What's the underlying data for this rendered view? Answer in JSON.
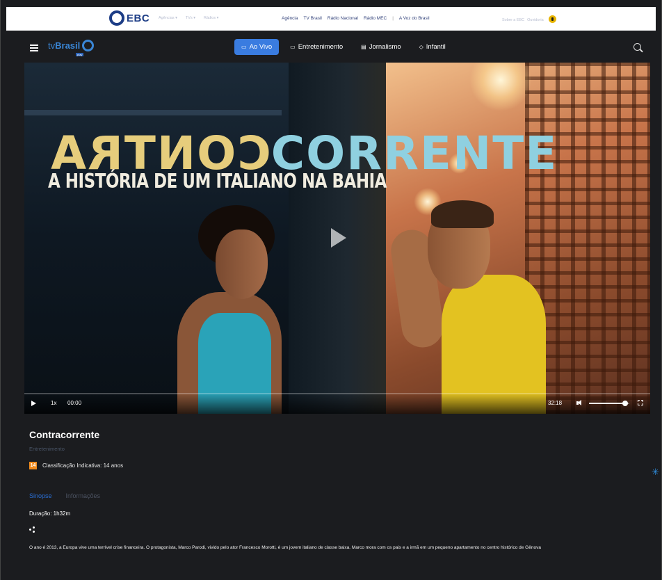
{
  "ebc_bar": {
    "logo_text": "EBC",
    "dropdowns": [
      "Agências ▾",
      "TVs ▾",
      "Rádios ▾"
    ],
    "links": [
      "Agência",
      "TV Brasil",
      "Rádio Nacional",
      "Rádio MEC",
      "A Voz do Brasil"
    ],
    "right_links": [
      "Sobre a EBC",
      "Ouvidoria"
    ]
  },
  "nav": {
    "logo_tv": "tv",
    "logo_brasil": "Brasil",
    "logo_play": "play",
    "items": [
      {
        "icon": "▭",
        "label": "Ao Vivo",
        "active": true
      },
      {
        "icon": "▭",
        "label": "Entretenimento",
        "active": false
      },
      {
        "icon": "▤",
        "label": "Jornalismo",
        "active": false
      },
      {
        "icon": "◇",
        "label": "Infantil",
        "active": false
      }
    ]
  },
  "video": {
    "poster_title_left": "CONTRA",
    "poster_title_right": "CORRENTE",
    "poster_subtitle": "A HISTÓRIA DE UM ITALIANO NA BAHIA",
    "playback_rate": "1x",
    "current_time": "00:00",
    "duration": "32:18",
    "progress_fraction": 0,
    "volume_fraction": 0.9
  },
  "program": {
    "title": "Contracorrente",
    "category": "Entretenimento",
    "rating_badge": "14",
    "rating_text": "Classificação Indicativa: 14 anos",
    "tabs": [
      {
        "label": "Sinopse",
        "active": true
      },
      {
        "label": "Informações",
        "active": false
      }
    ],
    "duration_text": "Duração: 1h32m",
    "synopsis": "O ano é 2013, a Europa vive uma terrível crise financeira. O protagonista, Marco Parodi, vivido pelo ator Francesco Morotti, é um jovem italiano de classe baixa. Marco mora com os pais e a irmã em um pequeno apartamento no centro histórico de Gênova"
  },
  "colors": {
    "accent": "#3a7ce0",
    "background": "#1b1c1f",
    "rating_orange": "#f08a1c"
  }
}
